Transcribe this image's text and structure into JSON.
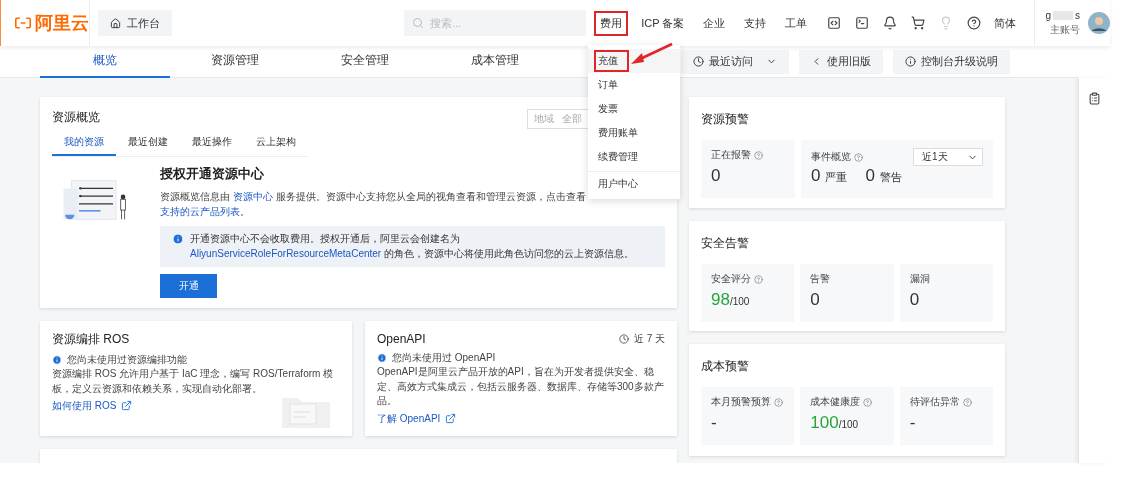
{
  "header": {
    "logo": "阿里云",
    "workbench": "工作台",
    "search": {
      "placeholder": "搜索..."
    },
    "nav": [
      {
        "label": "费用",
        "highlighted": true
      },
      {
        "label": "ICP 备案",
        "highlighted": false
      },
      {
        "label": "企业",
        "highlighted": false
      },
      {
        "label": "支持",
        "highlighted": false
      },
      {
        "label": "工单",
        "highlighted": false
      }
    ],
    "language": "简体",
    "user": {
      "name_start": "g",
      "name_end": "s",
      "role": "主账号"
    }
  },
  "tabs": [
    {
      "label": "概览",
      "selected": true
    },
    {
      "label": "资源管理",
      "selected": false
    },
    {
      "label": "安全管理",
      "selected": false
    },
    {
      "label": "成本管理",
      "selected": false
    }
  ],
  "toolbar": {
    "recent": "最近访问",
    "old_version": "使用旧版",
    "upgrade_notes": "控制台升级说明"
  },
  "fee_menu": {
    "items": [
      {
        "label": "充值",
        "highlighted": true
      },
      {
        "label": "订单",
        "highlighted": false
      },
      {
        "label": "发票",
        "highlighted": false
      },
      {
        "label": "费用账单",
        "highlighted": false
      },
      {
        "label": "续费管理",
        "highlighted": false
      }
    ],
    "footer": "用户中心"
  },
  "overview": {
    "title": "资源概览",
    "region_label": "地域",
    "region_value": "全部",
    "tabs": [
      {
        "label": "我的资源",
        "selected": true
      },
      {
        "label": "最近创建",
        "selected": false
      },
      {
        "label": "最近操作",
        "selected": false
      },
      {
        "label": "云上架构",
        "selected": false
      }
    ],
    "heading": "授权开通资源中心",
    "description": [
      "资源概览信息由 ",
      "资源中心",
      " 服务提供。资源中心支持您从全局的视角查看和管理云资源，点击查看 ",
      "支持的云产品列表",
      "。"
    ],
    "notice": [
      "开通资源中心不会收取费用。授权开通后，阿里云会创建名为 ",
      "AliyunServiceRoleForResourceMetaCenter",
      " 的角色，资源中心将使用此角色访问您的云上资源信息。"
    ],
    "button": "开通"
  },
  "ros": {
    "title": "资源编排 ROS",
    "status": "您尚未使用过资源编排功能",
    "body": "资源编排 ROS 允许用户基于 IaC 理念，编写 ROS/Terraform 模板，定义云资源和依赖关系，实现自动化部署。",
    "link": "如何使用 ROS"
  },
  "openapi": {
    "title": "OpenAPI",
    "period": "近 7 天",
    "status": "您尚未使用过 OpenAPI",
    "body": "OpenAPI是阿里云产品开放的API，旨在为开发者提供安全、稳定、高效方式集成云，包括云服务器、数据库、存储等300多款产品。",
    "link": "了解 OpenAPI"
  },
  "resource_alerts": {
    "title": "资源预警",
    "alarming": {
      "label": "正在报警",
      "value": "0"
    },
    "events": {
      "label": "事件概览",
      "period": "近1天",
      "critical_value": "0",
      "critical_label": "严重",
      "warning_value": "0",
      "warning_label": "警告"
    }
  },
  "security_alerts": {
    "title": "安全告警",
    "stats": [
      {
        "label": "安全评分",
        "help": true,
        "value": "98",
        "total": "/100",
        "good": true
      },
      {
        "label": "告警",
        "help": false,
        "value": "0",
        "good": false
      },
      {
        "label": "漏洞",
        "help": false,
        "value": "0",
        "good": false
      }
    ]
  },
  "cost_alerts": {
    "title": "成本预警",
    "stats": [
      {
        "label": "本月预警预算",
        "help": true,
        "value": "-",
        "good": false
      },
      {
        "label": "成本健康度",
        "help": true,
        "value": "100",
        "total": "/100",
        "good": true
      },
      {
        "label": "待评估异常",
        "help": true,
        "value": "-",
        "good": false
      }
    ]
  }
}
